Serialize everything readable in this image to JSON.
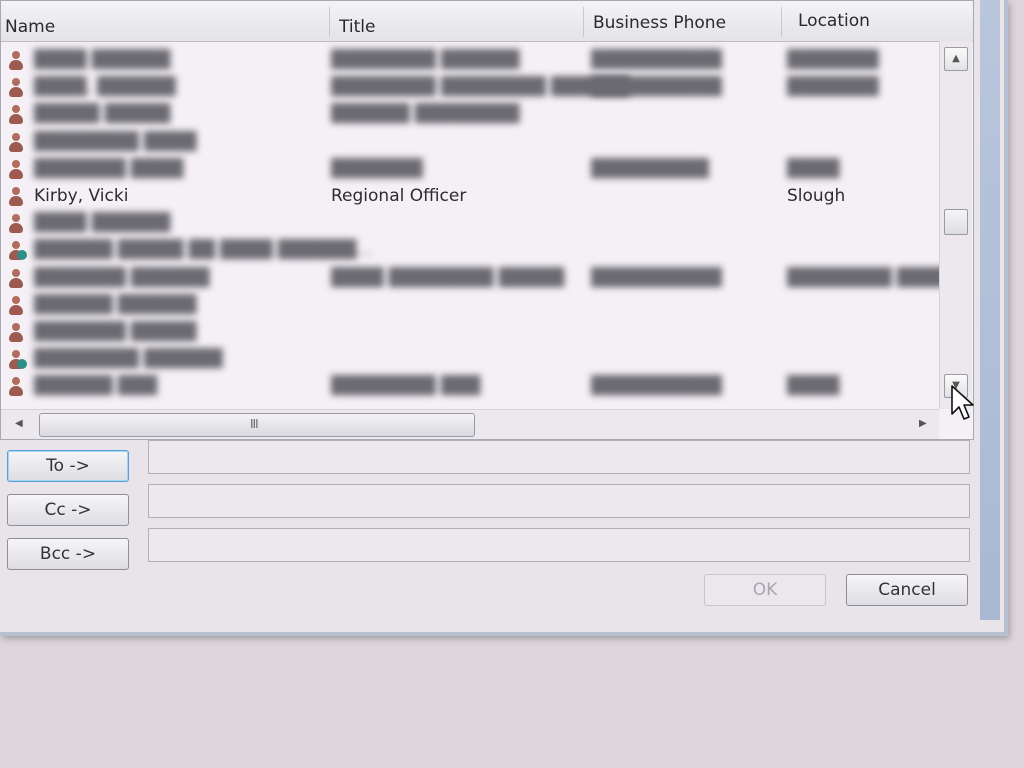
{
  "columns": {
    "name": "Name",
    "title": "Title",
    "phone": "Business Phone",
    "location": "Location"
  },
  "contacts": [
    {
      "name": "████ ██████",
      "title": "████████ ██████",
      "phone": "██████████",
      "location": "███████",
      "type": "user",
      "redacted": true
    },
    {
      "name": "████, ██████",
      "title": "████████ ████████ ██████",
      "phone": "██████████",
      "location": "███████",
      "type": "user",
      "redacted": true
    },
    {
      "name": "█████ █████",
      "title": "██████ ████████",
      "phone": "",
      "location": "",
      "type": "user",
      "redacted": true
    },
    {
      "name": "████████ ████",
      "title": "",
      "phone": "",
      "location": "",
      "type": "user",
      "redacted": true
    },
    {
      "name": "███████ ████",
      "title": "███████",
      "phone": "█████████",
      "location": "████",
      "type": "user",
      "redacted": true
    },
    {
      "name": "Kirby, Vicki",
      "title": "Regional Officer",
      "phone": "",
      "location": "Slough",
      "type": "user",
      "redacted": false
    },
    {
      "name": "████ ██████",
      "title": "",
      "phone": "",
      "location": "",
      "type": "user",
      "redacted": true
    },
    {
      "name": "██████ █████ ██ ████ ██████...",
      "title": "",
      "phone": "",
      "location": "",
      "type": "group",
      "redacted": true
    },
    {
      "name": "███████ ██████",
      "title": "████ ████████ █████",
      "phone": "██████████",
      "location": "████████ █████",
      "type": "user",
      "redacted": true
    },
    {
      "name": "██████ ██████",
      "title": "",
      "phone": "",
      "location": "",
      "type": "user",
      "redacted": true
    },
    {
      "name": "███████ █████",
      "title": "",
      "phone": "",
      "location": "",
      "type": "user",
      "redacted": true
    },
    {
      "name": "████████ ██████",
      "title": "",
      "phone": "",
      "location": "",
      "type": "group",
      "redacted": true
    },
    {
      "name": "██████ ███",
      "title": "████████ ███",
      "phone": "██████████",
      "location": "████",
      "type": "user",
      "redacted": true
    }
  ],
  "hscroll_grip": "III",
  "buttons": {
    "to": "To ->",
    "cc": "Cc ->",
    "bcc": "Bcc ->",
    "ok": "OK",
    "cancel": "Cancel"
  },
  "fields": {
    "to": "",
    "cc": "",
    "bcc": ""
  },
  "icons": {
    "user": "person-icon",
    "group": "group-icon",
    "scroll_up": "chevron-up-icon",
    "scroll_down": "chevron-down-icon",
    "scroll_left": "chevron-left-icon",
    "scroll_right": "chevron-right-icon",
    "cursor": "mouse-pointer-icon"
  }
}
